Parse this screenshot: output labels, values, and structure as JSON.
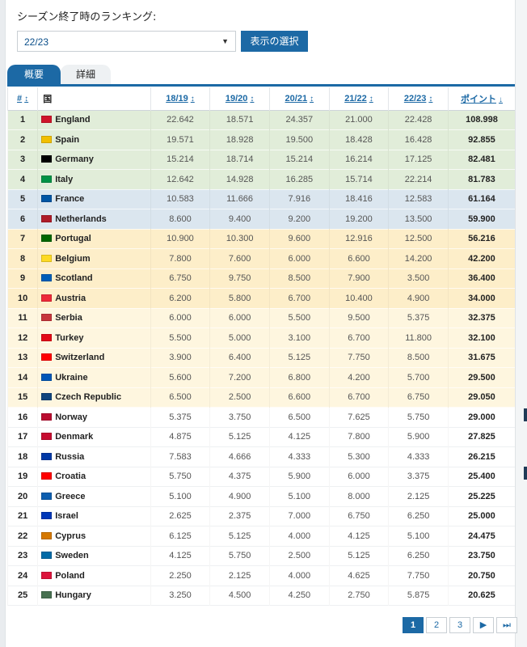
{
  "header": {
    "title": "シーズン終了時のランキング:",
    "season_select": "22/23",
    "show_button": "表示の選択"
  },
  "tabs": [
    {
      "label": "概要",
      "active": true
    },
    {
      "label": "詳細",
      "active": false
    }
  ],
  "table": {
    "columns": [
      "#",
      "国",
      "18/19",
      "19/20",
      "20/21",
      "21/22",
      "22/23",
      "ポイント"
    ],
    "rows": [
      {
        "rank": "1",
        "country": "England",
        "flag": "#cf142b",
        "v": [
          "22.642",
          "18.571",
          "24.357",
          "21.000",
          "22.428"
        ],
        "pts": "108.998",
        "group": "g1"
      },
      {
        "rank": "2",
        "country": "Spain",
        "flag": "#f1bf00",
        "v": [
          "19.571",
          "18.928",
          "19.500",
          "18.428",
          "16.428"
        ],
        "pts": "92.855",
        "group": "g1"
      },
      {
        "rank": "3",
        "country": "Germany",
        "flag": "#000000",
        "v": [
          "15.214",
          "18.714",
          "15.214",
          "16.214",
          "17.125"
        ],
        "pts": "82.481",
        "group": "g1"
      },
      {
        "rank": "4",
        "country": "Italy",
        "flag": "#009246",
        "v": [
          "12.642",
          "14.928",
          "16.285",
          "15.714",
          "22.214"
        ],
        "pts": "81.783",
        "group": "g1"
      },
      {
        "rank": "5",
        "country": "France",
        "flag": "#0055a4",
        "v": [
          "10.583",
          "11.666",
          "7.916",
          "18.416",
          "12.583"
        ],
        "pts": "61.164",
        "group": "g2"
      },
      {
        "rank": "6",
        "country": "Netherlands",
        "flag": "#ae1c28",
        "v": [
          "8.600",
          "9.400",
          "9.200",
          "19.200",
          "13.500"
        ],
        "pts": "59.900",
        "group": "g2"
      },
      {
        "rank": "7",
        "country": "Portugal",
        "flag": "#006600",
        "v": [
          "10.900",
          "10.300",
          "9.600",
          "12.916",
          "12.500"
        ],
        "pts": "56.216",
        "group": "g3"
      },
      {
        "rank": "8",
        "country": "Belgium",
        "flag": "#fdda24",
        "v": [
          "7.800",
          "7.600",
          "6.000",
          "6.600",
          "14.200"
        ],
        "pts": "42.200",
        "group": "g3"
      },
      {
        "rank": "9",
        "country": "Scotland",
        "flag": "#005eb8",
        "v": [
          "6.750",
          "9.750",
          "8.500",
          "7.900",
          "3.500"
        ],
        "pts": "36.400",
        "group": "g3"
      },
      {
        "rank": "10",
        "country": "Austria",
        "flag": "#ed2939",
        "v": [
          "6.200",
          "5.800",
          "6.700",
          "10.400",
          "4.900"
        ],
        "pts": "34.000",
        "group": "g3"
      },
      {
        "rank": "11",
        "country": "Serbia",
        "flag": "#c6363c",
        "v": [
          "6.000",
          "6.000",
          "5.500",
          "9.500",
          "5.375"
        ],
        "pts": "32.375",
        "group": "g4"
      },
      {
        "rank": "12",
        "country": "Turkey",
        "flag": "#e30a17",
        "v": [
          "5.500",
          "5.000",
          "3.100",
          "6.700",
          "11.800"
        ],
        "pts": "32.100",
        "group": "g4"
      },
      {
        "rank": "13",
        "country": "Switzerland",
        "flag": "#ff0000",
        "v": [
          "3.900",
          "6.400",
          "5.125",
          "7.750",
          "8.500"
        ],
        "pts": "31.675",
        "group": "g4"
      },
      {
        "rank": "14",
        "country": "Ukraine",
        "flag": "#0057b7",
        "v": [
          "5.600",
          "7.200",
          "6.800",
          "4.200",
          "5.700"
        ],
        "pts": "29.500",
        "group": "g4"
      },
      {
        "rank": "15",
        "country": "Czech Republic",
        "flag": "#11457e",
        "v": [
          "6.500",
          "2.500",
          "6.600",
          "6.700",
          "6.750"
        ],
        "pts": "29.050",
        "group": "g4"
      },
      {
        "rank": "16",
        "country": "Norway",
        "flag": "#ba0c2f",
        "v": [
          "5.375",
          "3.750",
          "6.500",
          "7.625",
          "5.750"
        ],
        "pts": "29.000",
        "group": "g5"
      },
      {
        "rank": "17",
        "country": "Denmark",
        "flag": "#c60c30",
        "v": [
          "4.875",
          "5.125",
          "4.125",
          "7.800",
          "5.900"
        ],
        "pts": "27.825",
        "group": "g5"
      },
      {
        "rank": "18",
        "country": "Russia",
        "flag": "#0039a6",
        "v": [
          "7.583",
          "4.666",
          "4.333",
          "5.300",
          "4.333"
        ],
        "pts": "26.215",
        "group": "g5"
      },
      {
        "rank": "19",
        "country": "Croatia",
        "flag": "#ff0000",
        "v": [
          "5.750",
          "4.375",
          "5.900",
          "6.000",
          "3.375"
        ],
        "pts": "25.400",
        "group": "g5"
      },
      {
        "rank": "20",
        "country": "Greece",
        "flag": "#0d5eaf",
        "v": [
          "5.100",
          "4.900",
          "5.100",
          "8.000",
          "2.125"
        ],
        "pts": "25.225",
        "group": "g5"
      },
      {
        "rank": "21",
        "country": "Israel",
        "flag": "#0038b8",
        "v": [
          "2.625",
          "2.375",
          "7.000",
          "6.750",
          "6.250"
        ],
        "pts": "25.000",
        "group": "g5"
      },
      {
        "rank": "22",
        "country": "Cyprus",
        "flag": "#d57800",
        "v": [
          "6.125",
          "5.125",
          "4.000",
          "4.125",
          "5.100"
        ],
        "pts": "24.475",
        "group": "g5"
      },
      {
        "rank": "23",
        "country": "Sweden",
        "flag": "#006aa7",
        "v": [
          "4.125",
          "5.750",
          "2.500",
          "5.125",
          "6.250"
        ],
        "pts": "23.750",
        "group": "g5"
      },
      {
        "rank": "24",
        "country": "Poland",
        "flag": "#dc143c",
        "v": [
          "2.250",
          "2.125",
          "4.000",
          "4.625",
          "7.750"
        ],
        "pts": "20.750",
        "group": "g5"
      },
      {
        "rank": "25",
        "country": "Hungary",
        "flag": "#477050",
        "v": [
          "3.250",
          "4.500",
          "4.250",
          "2.750",
          "5.875"
        ],
        "pts": "20.625",
        "group": "g5"
      }
    ]
  },
  "pagination": {
    "pages": [
      "1",
      "2",
      "3"
    ],
    "next": "▶",
    "last": "⏭"
  }
}
